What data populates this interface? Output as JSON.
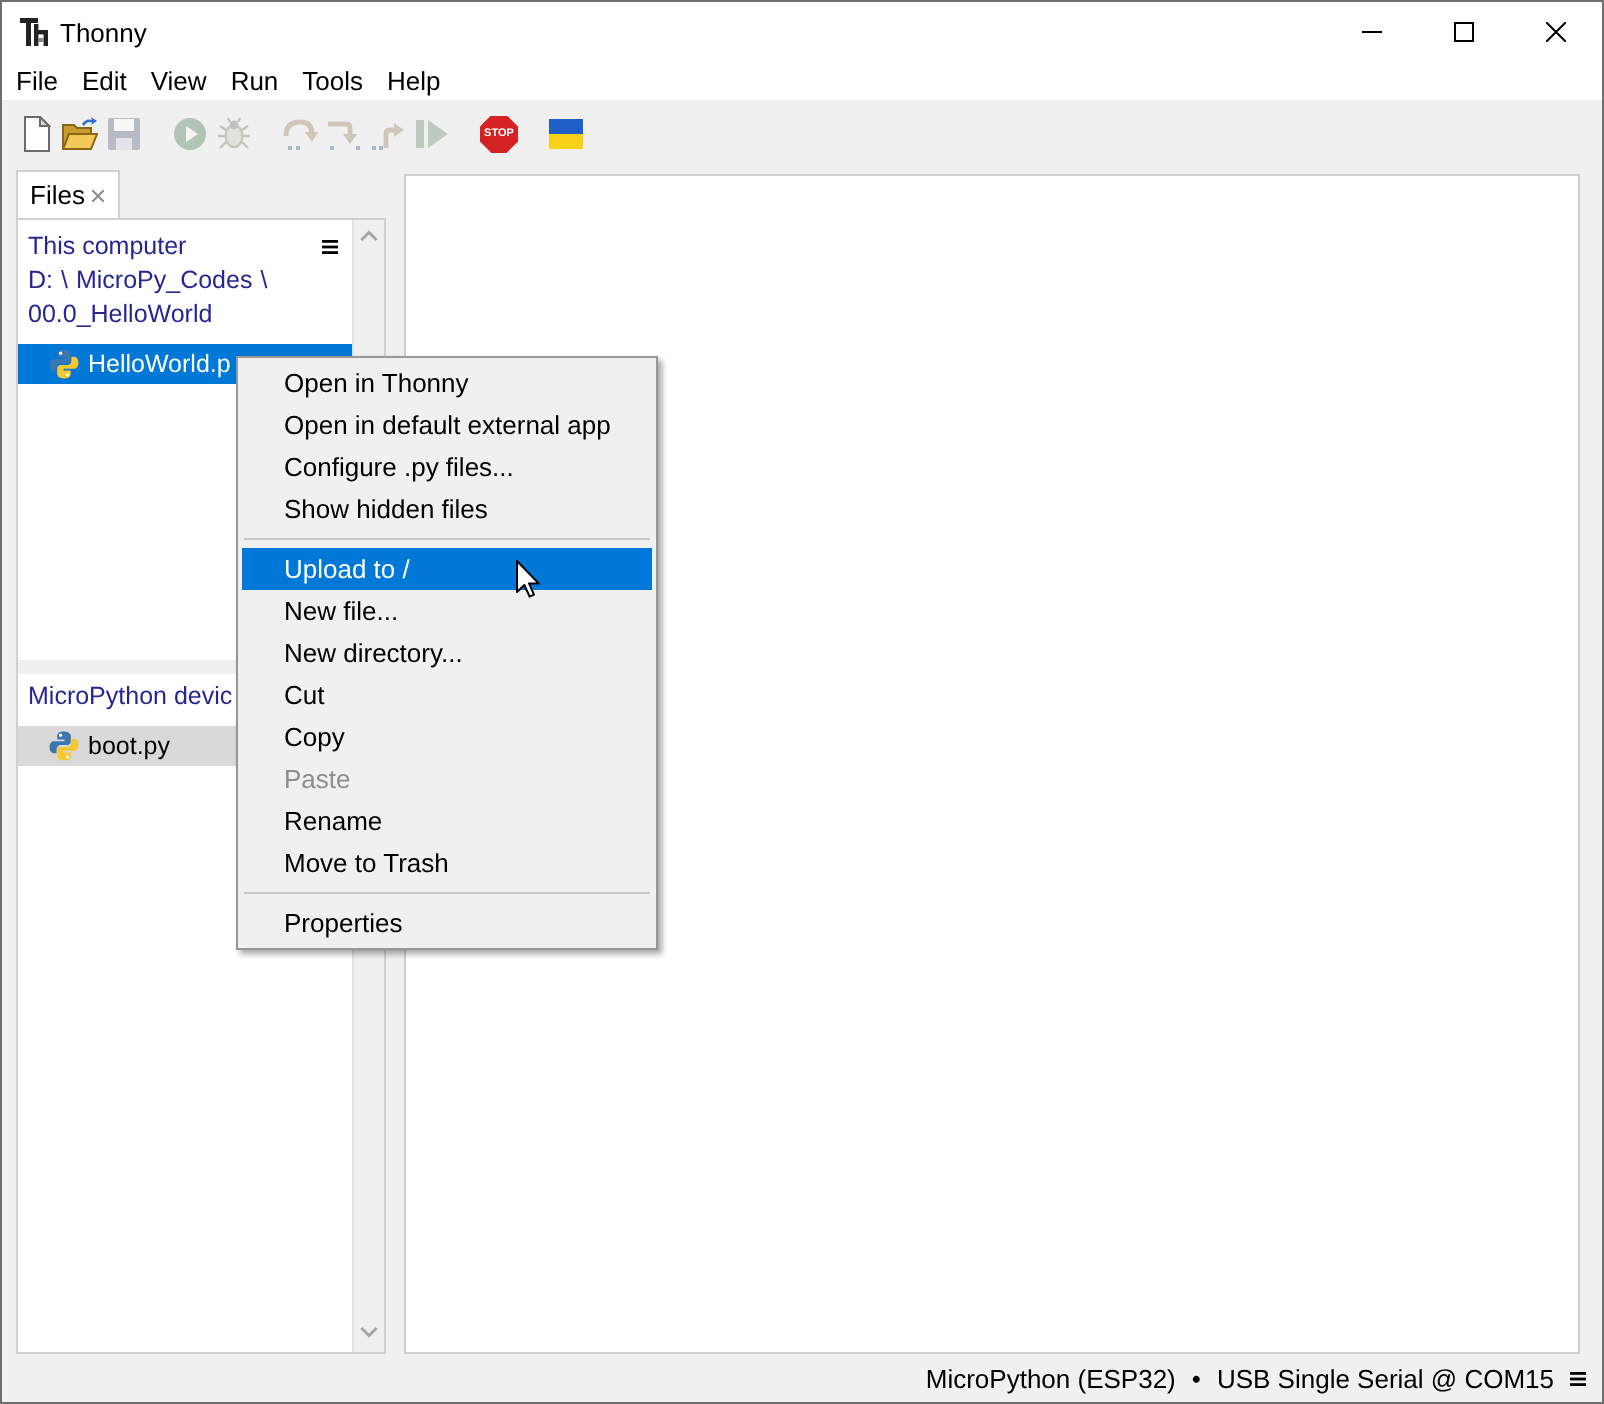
{
  "window": {
    "title": "Thonny"
  },
  "menu_bar": [
    "File",
    "Edit",
    "View",
    "Run",
    "Tools",
    "Help"
  ],
  "toolbar": [
    {
      "kind": "new",
      "disabled": false
    },
    {
      "kind": "open",
      "disabled": false
    },
    {
      "kind": "save",
      "disabled": true
    },
    {
      "kind": "run",
      "disabled": true
    },
    {
      "kind": "debug",
      "disabled": true
    },
    {
      "kind": "step-over",
      "disabled": true
    },
    {
      "kind": "step-into",
      "disabled": true
    },
    {
      "kind": "step-out",
      "disabled": true
    },
    {
      "kind": "resume",
      "disabled": true
    },
    {
      "kind": "stop",
      "label": "STOP",
      "disabled": false
    },
    {
      "kind": "flag",
      "disabled": false
    }
  ],
  "side_tabs": [
    {
      "label": "Files",
      "selected": true
    }
  ],
  "files": {
    "sections": [
      {
        "title": "This computer",
        "breadcrumb": [
          {
            "text": "D:",
            "separator": "\\"
          },
          {
            "text": "MicroPy_Codes",
            "separator": "\\"
          },
          {
            "text": "00.0_HelloWorld"
          }
        ],
        "focused": true,
        "items": [
          {
            "name": "HelloWorld.p",
            "selected": true
          }
        ]
      },
      {
        "title": "MicroPython devic",
        "focused": false,
        "items": [
          {
            "name": "boot.py",
            "selected": true
          }
        ]
      }
    ]
  },
  "context_menu": [
    {
      "kind": "item",
      "label": "Open in Thonny",
      "selected": false,
      "disabled": false
    },
    {
      "kind": "item",
      "label": "Open in default external app",
      "selected": false,
      "disabled": false
    },
    {
      "kind": "item",
      "label": "Configure .py files...",
      "selected": false,
      "disabled": false
    },
    {
      "kind": "item",
      "label": "Show hidden files",
      "selected": false,
      "disabled": false
    },
    {
      "kind": "separator"
    },
    {
      "kind": "item",
      "label": "Upload to /",
      "selected": true,
      "disabled": false
    },
    {
      "kind": "item",
      "label": "New file...",
      "selected": false,
      "disabled": false
    },
    {
      "kind": "item",
      "label": "New directory...",
      "selected": false,
      "disabled": false
    },
    {
      "kind": "item",
      "label": "Cut",
      "selected": false,
      "disabled": false
    },
    {
      "kind": "item",
      "label": "Copy",
      "selected": false,
      "disabled": false
    },
    {
      "kind": "item",
      "label": "Paste",
      "selected": false,
      "disabled": true
    },
    {
      "kind": "item",
      "label": "Rename",
      "selected": false,
      "disabled": false
    },
    {
      "kind": "item",
      "label": "Move to Trash",
      "selected": false,
      "disabled": false
    },
    {
      "kind": "separator"
    },
    {
      "kind": "item",
      "label": "Properties",
      "selected": false,
      "disabled": false
    }
  ],
  "status_bar": {
    "interpreter": "MicroPython (ESP32)",
    "separator": "•",
    "port": "USB Single Serial @ COM15"
  }
}
